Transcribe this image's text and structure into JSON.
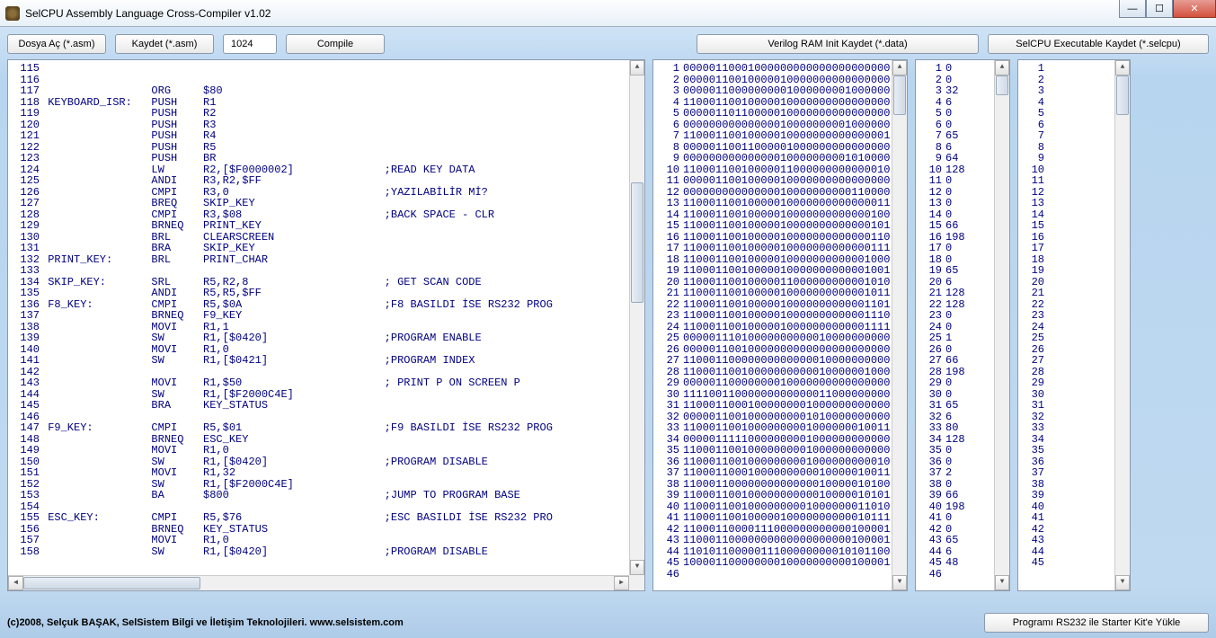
{
  "window": {
    "title": "SelCPU Assembly Language Cross-Compiler v1.02"
  },
  "toolbar": {
    "open": "Dosya Aç (*.asm)",
    "save": "Kaydet (*.asm)",
    "num": "1024",
    "compile": "Compile",
    "vram": "Verilog RAM Init  Kaydet (*.data)",
    "exec": "SelCPU Executable Kaydet (*.selcpu)"
  },
  "footer": {
    "copy": "(c)2008, Selçuk BAŞAK, SelSistem Bilgi ve İletişim Teknolojileri.   www.selsistem.com",
    "upload": "Programı RS232 ile Starter Kit'e Yükle"
  },
  "asm": [
    {
      "n": 115,
      "t": ""
    },
    {
      "n": 116,
      "t": ""
    },
    {
      "n": 117,
      "t": "                ORG     $80"
    },
    {
      "n": 118,
      "t": "KEYBOARD_ISR:   PUSH    R1"
    },
    {
      "n": 119,
      "t": "                PUSH    R2"
    },
    {
      "n": 120,
      "t": "                PUSH    R3"
    },
    {
      "n": 121,
      "t": "                PUSH    R4"
    },
    {
      "n": 122,
      "t": "                PUSH    R5"
    },
    {
      "n": 123,
      "t": "                PUSH    BR"
    },
    {
      "n": 124,
      "t": "                LW      R2,[$F0000002]              ;READ KEY DATA"
    },
    {
      "n": 125,
      "t": "                ANDI    R3,R2,$FF"
    },
    {
      "n": 126,
      "t": "                CMPI    R3,0                        ;YAZILABİLİR Mİ?"
    },
    {
      "n": 127,
      "t": "                BREQ    SKIP_KEY"
    },
    {
      "n": 128,
      "t": "                CMPI    R3,$08                      ;BACK SPACE - CLR"
    },
    {
      "n": 129,
      "t": "                BRNEQ   PRINT_KEY"
    },
    {
      "n": 130,
      "t": "                BRL     CLEARSCREEN"
    },
    {
      "n": 131,
      "t": "                BRA     SKIP_KEY"
    },
    {
      "n": 132,
      "t": "PRINT_KEY:      BRL     PRINT_CHAR"
    },
    {
      "n": 133,
      "t": ""
    },
    {
      "n": 134,
      "t": "SKIP_KEY:       SRL     R5,R2,8                     ; GET SCAN CODE"
    },
    {
      "n": 135,
      "t": "                ANDI    R5,R5,$FF"
    },
    {
      "n": 136,
      "t": "F8_KEY:         CMPI    R5,$0A                      ;F8 BASILDI İSE RS232 PROG"
    },
    {
      "n": 137,
      "t": "                BRNEQ   F9_KEY"
    },
    {
      "n": 138,
      "t": "                MOVI    R1,1"
    },
    {
      "n": 139,
      "t": "                SW      R1,[$0420]                  ;PROGRAM ENABLE"
    },
    {
      "n": 140,
      "t": "                MOVI    R1,0"
    },
    {
      "n": 141,
      "t": "                SW      R1,[$0421]                  ;PROGRAM INDEX"
    },
    {
      "n": 142,
      "t": ""
    },
    {
      "n": 143,
      "t": "                MOVI    R1,$50                      ; PRINT P ON SCREEN P"
    },
    {
      "n": 144,
      "t": "                SW      R1,[$F2000C4E]"
    },
    {
      "n": 145,
      "t": "                BRA     KEY_STATUS"
    },
    {
      "n": 146,
      "t": ""
    },
    {
      "n": 147,
      "t": "F9_KEY:         CMPI    R5,$01                      ;F9 BASILDI İSE RS232 PROG"
    },
    {
      "n": 148,
      "t": "                BRNEQ   ESC_KEY"
    },
    {
      "n": 149,
      "t": "                MOVI    R1,0"
    },
    {
      "n": 150,
      "t": "                SW      R1,[$0420]                  ;PROGRAM DISABLE"
    },
    {
      "n": 151,
      "t": "                MOVI    R1,32"
    },
    {
      "n": 152,
      "t": "                SW      R1,[$F2000C4E]"
    },
    {
      "n": 153,
      "t": "                BA      $800                        ;JUMP TO PROGRAM BASE"
    },
    {
      "n": 154,
      "t": ""
    },
    {
      "n": 155,
      "t": "ESC_KEY:        CMPI    R5,$76                      ;ESC BASILDI İSE RS232 PRO"
    },
    {
      "n": 156,
      "t": "                BRNEQ   KEY_STATUS"
    },
    {
      "n": 157,
      "t": "                MOVI    R1,0"
    },
    {
      "n": 158,
      "t": "                SW      R1,[$0420]                  ;PROGRAM DISABLE"
    }
  ],
  "bin": [
    {
      "n": 1,
      "t": "00000110001000000000000000000000"
    },
    {
      "n": 2,
      "t": "00000110010000010000000000000000"
    },
    {
      "n": 3,
      "t": "00000110000000001000000001000000"
    },
    {
      "n": 4,
      "t": "11000110010000010000000000000000"
    },
    {
      "n": 5,
      "t": "00000110110000010000000000000000"
    },
    {
      "n": 6,
      "t": "00000000000000010000000001000000"
    },
    {
      "n": 7,
      "t": "11000110010000010000000000000001"
    },
    {
      "n": 8,
      "t": "00000110011000001000000000000000"
    },
    {
      "n": 9,
      "t": "00000000000000010000000001010000"
    },
    {
      "n": 10,
      "t": "11000110010000011000000000000010"
    },
    {
      "n": 11,
      "t": "00000110010000010000000000000000"
    },
    {
      "n": 12,
      "t": "00000000000000010000000000110000"
    },
    {
      "n": 13,
      "t": "11000110010000010000000000000011"
    },
    {
      "n": 14,
      "t": "11000110010000010000000000000100"
    },
    {
      "n": 15,
      "t": "11000110010000010000000000000101"
    },
    {
      "n": 16,
      "t": "11000110010000010000000000000110"
    },
    {
      "n": 17,
      "t": "11000110010000010000000000000111"
    },
    {
      "n": 18,
      "t": "11000110010000010000000000001000"
    },
    {
      "n": 19,
      "t": "11000110010000010000000000001001"
    },
    {
      "n": 20,
      "t": "11000110010000011000000000001010"
    },
    {
      "n": 21,
      "t": "11000110010000010000000000001011"
    },
    {
      "n": 22,
      "t": "11000110010000010000000000001101"
    },
    {
      "n": 23,
      "t": "11000110010000010000000000001110"
    },
    {
      "n": 24,
      "t": "11000110010000010000000000001111"
    },
    {
      "n": 25,
      "t": "00000111010000000000010000000000"
    },
    {
      "n": 26,
      "t": "00000110010000000000000000000000"
    },
    {
      "n": 27,
      "t": "11000110000000000000010000000000"
    },
    {
      "n": 28,
      "t": "11000110010000000000010000001000"
    },
    {
      "n": 29,
      "t": "00000110000000010000000000000000"
    },
    {
      "n": 30,
      "t": "11110011000000000000011000000000"
    },
    {
      "n": 31,
      "t": "11000110001000000001000000000000"
    },
    {
      "n": 32,
      "t": "00000110010000000001010000000000"
    },
    {
      "n": 33,
      "t": "11000110010000000001000000010011"
    },
    {
      "n": 34,
      "t": "00000111110000000001000000000000"
    },
    {
      "n": 35,
      "t": "11000110010000000001000000000000"
    },
    {
      "n": 36,
      "t": "11000110010000000001000000000010"
    },
    {
      "n": 37,
      "t": "11000110001000000000010000010011"
    },
    {
      "n": 38,
      "t": "11000110000000000000010000010100"
    },
    {
      "n": 39,
      "t": "11000110010000000000010000010101"
    },
    {
      "n": 40,
      "t": "11000110010000000001000000011010"
    },
    {
      "n": 41,
      "t": "11000110010000010000000000010111"
    },
    {
      "n": 42,
      "t": "11000110000111000000000000100001"
    },
    {
      "n": 43,
      "t": "11000110000000000000000000100001"
    },
    {
      "n": 44,
      "t": "11010110000011100000000010101100"
    },
    {
      "n": 45,
      "t": "10000110000000010000000000100001"
    },
    {
      "n": 46,
      "t": ""
    }
  ],
  "col3": [
    {
      "n": 1,
      "v": "0"
    },
    {
      "n": 2,
      "v": "0"
    },
    {
      "n": 3,
      "v": "32"
    },
    {
      "n": 4,
      "v": "6"
    },
    {
      "n": 5,
      "v": "0"
    },
    {
      "n": 6,
      "v": "0"
    },
    {
      "n": 7,
      "v": "65"
    },
    {
      "n": 8,
      "v": "6"
    },
    {
      "n": 9,
      "v": "64"
    },
    {
      "n": 10,
      "v": "128"
    },
    {
      "n": 11,
      "v": "0"
    },
    {
      "n": 12,
      "v": "0"
    },
    {
      "n": 13,
      "v": "0"
    },
    {
      "n": 14,
      "v": "0"
    },
    {
      "n": 15,
      "v": "66"
    },
    {
      "n": 16,
      "v": "198"
    },
    {
      "n": 17,
      "v": "0"
    },
    {
      "n": 18,
      "v": "0"
    },
    {
      "n": 19,
      "v": "65"
    },
    {
      "n": 20,
      "v": "6"
    },
    {
      "n": 21,
      "v": "128"
    },
    {
      "n": 22,
      "v": "128"
    },
    {
      "n": 23,
      "v": "0"
    },
    {
      "n": 24,
      "v": "0"
    },
    {
      "n": 25,
      "v": "1"
    },
    {
      "n": 26,
      "v": "0"
    },
    {
      "n": 27,
      "v": "66"
    },
    {
      "n": 28,
      "v": "198"
    },
    {
      "n": 29,
      "v": "0"
    },
    {
      "n": 30,
      "v": "0"
    },
    {
      "n": 31,
      "v": "65"
    },
    {
      "n": 32,
      "v": "6"
    },
    {
      "n": 33,
      "v": "80"
    },
    {
      "n": 34,
      "v": "128"
    },
    {
      "n": 35,
      "v": "0"
    },
    {
      "n": 36,
      "v": "0"
    },
    {
      "n": 37,
      "v": "2"
    },
    {
      "n": 38,
      "v": "0"
    },
    {
      "n": 39,
      "v": "66"
    },
    {
      "n": 40,
      "v": "198"
    },
    {
      "n": 41,
      "v": "0"
    },
    {
      "n": 42,
      "v": "0"
    },
    {
      "n": 43,
      "v": "65"
    },
    {
      "n": 44,
      "v": "6"
    },
    {
      "n": 45,
      "v": "48"
    },
    {
      "n": 46,
      "v": ""
    }
  ],
  "col4": [
    1,
    2,
    3,
    4,
    5,
    6,
    7,
    8,
    9,
    10,
    11,
    12,
    13,
    14,
    15,
    16,
    17,
    18,
    19,
    20,
    21,
    22,
    23,
    24,
    25,
    26,
    27,
    28,
    29,
    30,
    31,
    32,
    33,
    34,
    35,
    36,
    37,
    38,
    39,
    40,
    41,
    42,
    43,
    44,
    45,
    ""
  ]
}
